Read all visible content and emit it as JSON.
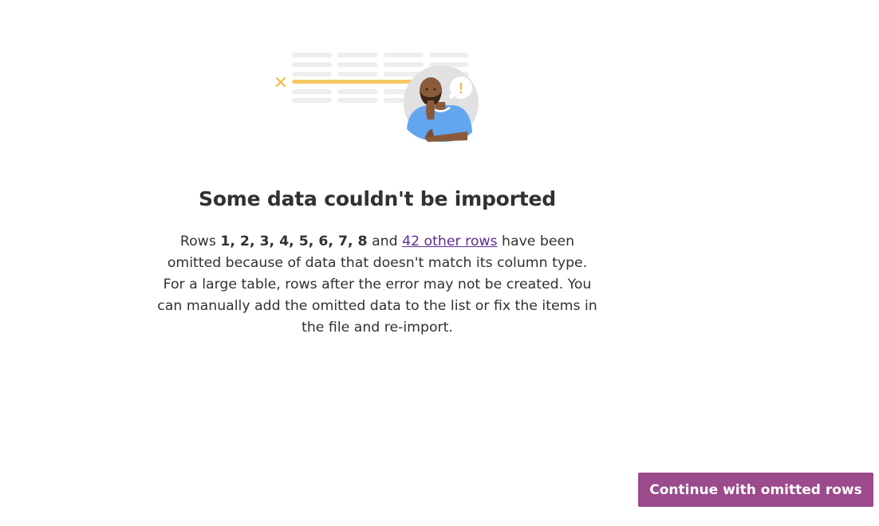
{
  "illustration": {
    "icon": "person-thinking-error-icon",
    "accent_color": "#f6c964",
    "error_marker": "×",
    "alert_mark": "!"
  },
  "dialog": {
    "title": "Some data couldn't be imported",
    "rows_prefix": "Rows ",
    "rows_list": "1, 2, 3, 4, 5, 6, 7, 8",
    "rows_and": " and ",
    "other_rows_link": "42 other rows",
    "rows_suffix": " have been omitted because of data that doesn't match its column type.",
    "detail": "For a large table, rows after the error may not be created. You can manually add the omitted data to the list or fix the items in the file and re-import."
  },
  "actions": {
    "continue_label": "Continue with omitted rows",
    "continue_color": "#9b4a8c"
  },
  "colors": {
    "link": "#5c2e91",
    "text": "#323130"
  }
}
